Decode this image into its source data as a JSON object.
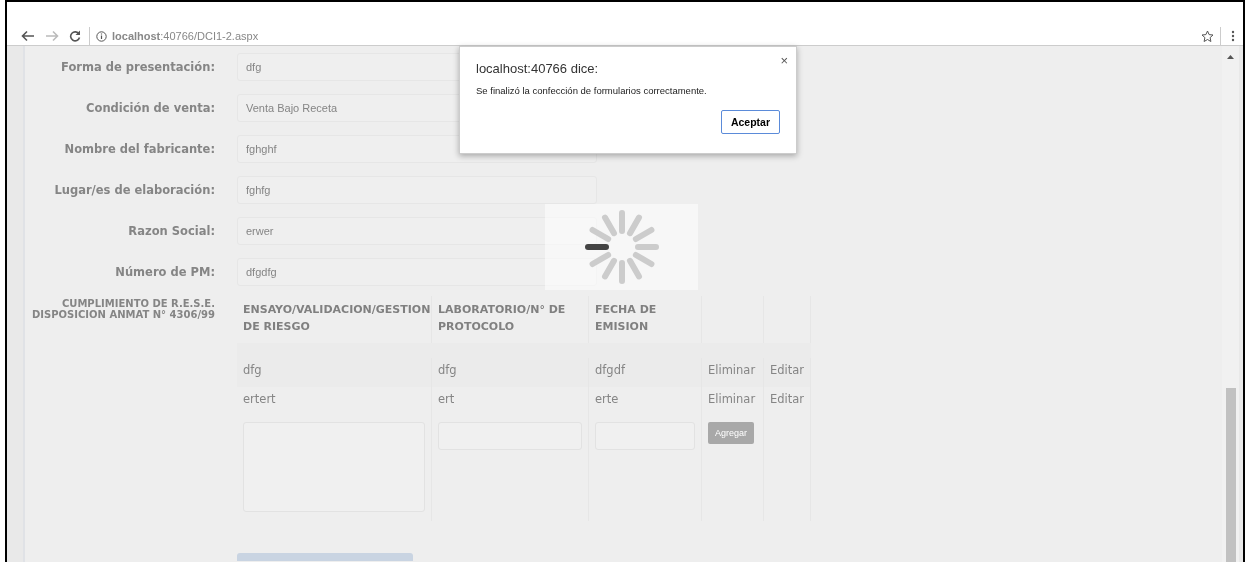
{
  "browser": {
    "url": "**localhost**:40766/DCI1-2.aspx"
  },
  "form": {
    "fields": [
      {
        "label": "Forma de presentación:",
        "value": "dfg"
      },
      {
        "label": "Condición de venta:",
        "value": "Venta Bajo Receta"
      },
      {
        "label": "Nombre del fabricante:",
        "value": "fghghf"
      },
      {
        "label": "Lugar/es de elaboración:",
        "value": "fghfg"
      },
      {
        "label": "Razon Social:",
        "value": "erwer"
      },
      {
        "label": "Número de PM:",
        "value": "dfgdfg"
      }
    ],
    "section_label": "CUMPLIMIENTO DE R.E.S.E. DISPOSICION ANMAT N° 4306/99",
    "table": {
      "columns": [
        "ENSAYO/VALIDACION/GESTION DE RIESGO",
        "LABORATORIO/N° DE PROTOCOLO",
        "FECHA DE EMISION"
      ],
      "rows": [
        {
          "cells": [
            "dfg",
            "dfg",
            "dfgdf"
          ],
          "actions": [
            "Eliminar",
            "Editar"
          ]
        },
        {
          "cells": [
            "ertert",
            "ert",
            "erte"
          ],
          "actions": [
            "Eliminar",
            "Editar"
          ]
        }
      ],
      "add_button": "Agregar"
    }
  },
  "loading": true,
  "dialog": {
    "title": "localhost:40766 dice:",
    "close": "×",
    "message": "Se finalizó la confección de formularios correctamente.",
    "button": "Aceptar"
  }
}
